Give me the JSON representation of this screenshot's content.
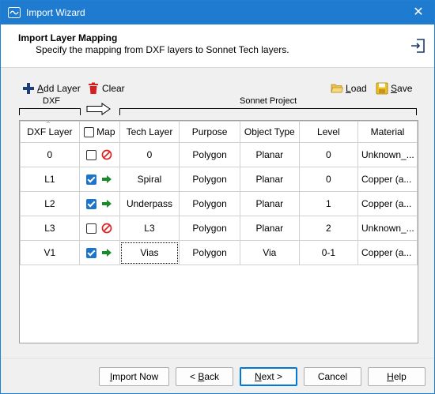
{
  "window": {
    "title": "Import Wizard",
    "close_glyph": "✕"
  },
  "header": {
    "title": "Import Layer Mapping",
    "subtitle": "Specify the mapping from DXF layers to Sonnet Tech layers."
  },
  "toolbar": {
    "add_layer_mnemonic": "A",
    "add_layer_rest": "dd Layer",
    "clear_label": "Clear",
    "load_mnemonic": "L",
    "load_rest": "oad",
    "save_mnemonic": "S",
    "save_rest": "ave"
  },
  "brackets": {
    "dxf": "DXF",
    "sonnet": "Sonnet Project"
  },
  "columns": {
    "dxf_layer": "DXF Layer",
    "map": "Map",
    "tech_layer": "Tech Layer",
    "purpose": "Purpose",
    "object_type": "Object Type",
    "level": "Level",
    "material": "Material"
  },
  "rows": [
    {
      "dxf_layer": "0",
      "mapped": false,
      "tech_layer": "0",
      "purpose": "Polygon",
      "object_type": "Planar",
      "level": "0",
      "material": "Unknown_..."
    },
    {
      "dxf_layer": "L1",
      "mapped": true,
      "tech_layer": "Spiral",
      "purpose": "Polygon",
      "object_type": "Planar",
      "level": "0",
      "material": "Copper (a..."
    },
    {
      "dxf_layer": "L2",
      "mapped": true,
      "tech_layer": "Underpass",
      "purpose": "Polygon",
      "object_type": "Planar",
      "level": "1",
      "material": "Copper (a..."
    },
    {
      "dxf_layer": "L3",
      "mapped": false,
      "tech_layer": "L3",
      "purpose": "Polygon",
      "object_type": "Planar",
      "level": "2",
      "material": "Unknown_..."
    },
    {
      "dxf_layer": "V1",
      "mapped": true,
      "tech_layer": "Vias",
      "purpose": "Polygon",
      "object_type": "Via",
      "level": "0-1",
      "material": "Copper (a..."
    }
  ],
  "buttons": {
    "import_now_mnemonic": "I",
    "import_now_rest": "mport Now",
    "back_prefix": "< ",
    "back_mnemonic": "B",
    "back_rest": "ack",
    "next_mnemonic": "N",
    "next_rest": "ext >",
    "cancel_label": "Cancel",
    "help_mnemonic": "H",
    "help_rest": "elp"
  },
  "colors": {
    "titlebar": "#1e7bcf",
    "checkbox_checked": "#1e74c9",
    "mapped_arrow": "#1a8a2a",
    "unmapped_icon": "#e02020",
    "clear_icon": "#d32020",
    "folder_icon": "#e8c04a",
    "save_icon": "#f0c020"
  }
}
